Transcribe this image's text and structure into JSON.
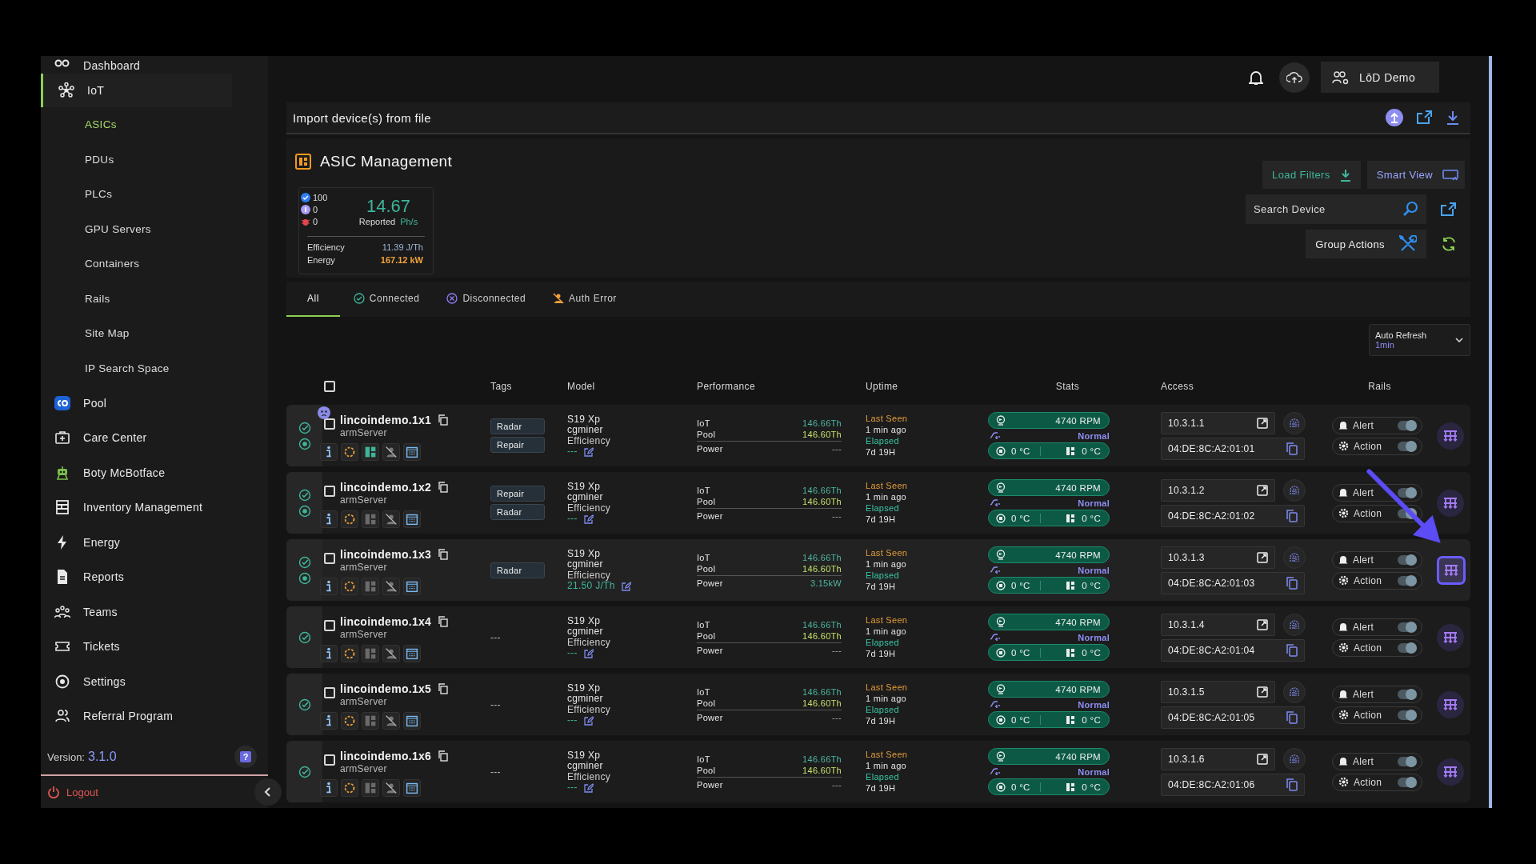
{
  "sidebar": {
    "items": [
      {
        "label": "Dashboard",
        "selected": false
      },
      {
        "label": "IoT",
        "selected": true,
        "children": [
          {
            "label": "ASICs",
            "selected": true
          },
          {
            "label": "PDUs",
            "selected": false
          },
          {
            "label": "PLCs",
            "selected": false
          },
          {
            "label": "GPU Servers",
            "selected": false
          },
          {
            "label": "Containers",
            "selected": false
          },
          {
            "label": "Rails",
            "selected": false
          },
          {
            "label": "Site Map",
            "selected": false
          },
          {
            "label": "IP Search Space",
            "selected": false
          }
        ]
      },
      {
        "label": "Pool",
        "selected": false
      },
      {
        "label": "Care Center",
        "selected": false
      },
      {
        "label": "Boty McBotface",
        "selected": false
      },
      {
        "label": "Inventory Management",
        "selected": false
      },
      {
        "label": "Energy",
        "selected": false
      },
      {
        "label": "Reports",
        "selected": false
      },
      {
        "label": "Teams",
        "selected": false
      },
      {
        "label": "Tickets",
        "selected": false
      },
      {
        "label": "Settings",
        "selected": false
      },
      {
        "label": "Referral Program",
        "selected": false
      }
    ],
    "version": {
      "label": "Version:",
      "value": "3.1.0"
    },
    "help": "?",
    "logout": "Logout"
  },
  "topbar": {
    "user": "LōD Demo"
  },
  "import_bar": {
    "title": "Import device(s) from file"
  },
  "asic_panel": {
    "title": "ASIC Management",
    "summary": {
      "counts": [
        {
          "value": "100",
          "color": "#2f7df6"
        },
        {
          "value": "0",
          "color": "#a99cf5"
        },
        {
          "value": "0",
          "color": "#e0474c"
        }
      ],
      "hashrate": "14.67",
      "hashrate_label": "Reported",
      "hashrate_unit": "Ph/s",
      "metrics": [
        {
          "label": "Efficiency",
          "value": "11.39 J/Th"
        },
        {
          "label": "Energy",
          "value": "167.12 kW"
        }
      ]
    },
    "load_filters": "Load Filters",
    "smart_view": "Smart View",
    "search": {
      "placeholder": "Search Device"
    },
    "group_actions": "Group Actions"
  },
  "tabs": [
    {
      "label": "All",
      "kind": "all",
      "selected": true
    },
    {
      "label": "Connected",
      "kind": "connected",
      "selected": false
    },
    {
      "label": "Disconnected",
      "kind": "disconnected",
      "selected": false
    },
    {
      "label": "Auth Error",
      "kind": "auth_error",
      "selected": false
    }
  ],
  "auto_refresh": {
    "label": "Auto Refresh",
    "value": "1min"
  },
  "table": {
    "select_all": {
      "checked": false
    },
    "columns": [
      "Tags",
      "Model",
      "Performance",
      "Uptime",
      "Stats",
      "Access",
      "Rails"
    ],
    "rows": [
      {
        "name": "lincoindemo.1x1",
        "server": "armServer",
        "checked": false,
        "hovered": false,
        "notice": true,
        "connected": true,
        "online": true,
        "layout_active": true,
        "tags": [
          "Radar",
          "Repair"
        ],
        "model": "S19 Xp",
        "miner": "cgminer",
        "efficiency_label": "Efficiency",
        "efficiency": "---",
        "perf": [
          {
            "label": "IoT",
            "value": "146.66Th"
          },
          {
            "label": "Pool",
            "value": "146.60Th"
          },
          {
            "label": "Power",
            "value": "---"
          }
        ],
        "last_seen_label": "Last Seen",
        "last_seen": "1 min ago",
        "elapsed_label": "Elapsed",
        "elapsed": "7d 19H",
        "rpm": "4740 RPM",
        "power_mode": "Normal",
        "temps": [
          "0 °C",
          "0 °C"
        ],
        "ip": "10.3.1.1",
        "mac": "04:DE:8C:A2:01:01",
        "rails": [
          {
            "label": "Alert",
            "on": true
          },
          {
            "label": "Action",
            "on": true
          }
        ]
      },
      {
        "name": "lincoindemo.1x2",
        "server": "armServer",
        "checked": false,
        "hovered": false,
        "notice": false,
        "connected": true,
        "online": true,
        "layout_active": false,
        "tags": [
          "Repair",
          "Radar"
        ],
        "model": "S19 Xp",
        "miner": "cgminer",
        "efficiency_label": "Efficiency",
        "efficiency": "---",
        "perf": [
          {
            "label": "IoT",
            "value": "146.66Th"
          },
          {
            "label": "Pool",
            "value": "146.60Th"
          },
          {
            "label": "Power",
            "value": "---"
          }
        ],
        "last_seen_label": "Last Seen",
        "last_seen": "1 min ago",
        "elapsed_label": "Elapsed",
        "elapsed": "7d 19H",
        "rpm": "4740 RPM",
        "power_mode": "Normal",
        "temps": [
          "0 °C",
          "0 °C"
        ],
        "ip": "10.3.1.2",
        "mac": "04:DE:8C:A2:01:02",
        "rails": [
          {
            "label": "Alert",
            "on": true
          },
          {
            "label": "Action",
            "on": true
          }
        ]
      },
      {
        "name": "lincoindemo.1x3",
        "server": "armServer",
        "checked": false,
        "hovered": true,
        "notice": false,
        "connected": true,
        "online": true,
        "layout_active": false,
        "tags": [
          "Radar"
        ],
        "model": "S19 Xp",
        "miner": "cgminer",
        "efficiency_label": "Efficiency",
        "efficiency": "21.50 J/Th",
        "perf": [
          {
            "label": "IoT",
            "value": "146.66Th"
          },
          {
            "label": "Pool",
            "value": "146.60Th"
          },
          {
            "label": "Power",
            "value": "3.15kW"
          }
        ],
        "last_seen_label": "Last Seen",
        "last_seen": "1 min ago",
        "elapsed_label": "Elapsed",
        "elapsed": "7d 19H",
        "rpm": "4740 RPM",
        "power_mode": "Normal",
        "temps": [
          "0 °C",
          "0 °C"
        ],
        "ip": "10.3.1.3",
        "mac": "04:DE:8C:A2:01:03",
        "rails": [
          {
            "label": "Alert",
            "on": true
          },
          {
            "label": "Action",
            "on": true
          }
        ]
      },
      {
        "name": "lincoindemo.1x4",
        "server": "armServer",
        "checked": false,
        "hovered": false,
        "notice": false,
        "connected": true,
        "online": false,
        "layout_active": false,
        "tags_empty": "---",
        "model": "S19 Xp",
        "miner": "cgminer",
        "efficiency_label": "Efficiency",
        "efficiency": "---",
        "perf": [
          {
            "label": "IoT",
            "value": "146.66Th"
          },
          {
            "label": "Pool",
            "value": "146.60Th"
          },
          {
            "label": "Power",
            "value": "---"
          }
        ],
        "last_seen_label": "Last Seen",
        "last_seen": "1 min ago",
        "elapsed_label": "Elapsed",
        "elapsed": "7d 19H",
        "rpm": "4740 RPM",
        "power_mode": "Normal",
        "temps": [
          "0 °C",
          "0 °C"
        ],
        "ip": "10.3.1.4",
        "mac": "04:DE:8C:A2:01:04",
        "rails": [
          {
            "label": "Alert",
            "on": true
          },
          {
            "label": "Action",
            "on": true
          }
        ]
      },
      {
        "name": "lincoindemo.1x5",
        "server": "armServer",
        "checked": false,
        "hovered": false,
        "notice": false,
        "connected": true,
        "online": false,
        "layout_active": false,
        "tags_empty": "---",
        "model": "S19 Xp",
        "miner": "cgminer",
        "efficiency_label": "Efficiency",
        "efficiency": "---",
        "perf": [
          {
            "label": "IoT",
            "value": "146.66Th"
          },
          {
            "label": "Pool",
            "value": "146.60Th"
          },
          {
            "label": "Power",
            "value": "---"
          }
        ],
        "last_seen_label": "Last Seen",
        "last_seen": "1 min ago",
        "elapsed_label": "Elapsed",
        "elapsed": "7d 19H",
        "rpm": "4740 RPM",
        "power_mode": "Normal",
        "temps": [
          "0 °C",
          "0 °C"
        ],
        "ip": "10.3.1.5",
        "mac": "04:DE:8C:A2:01:05",
        "rails": [
          {
            "label": "Alert",
            "on": true
          },
          {
            "label": "Action",
            "on": true
          }
        ]
      },
      {
        "name": "lincoindemo.1x6",
        "server": "armServer",
        "checked": false,
        "hovered": false,
        "notice": false,
        "connected": true,
        "online": false,
        "layout_active": false,
        "tags_empty": "---",
        "model": "S19 Xp",
        "miner": "cgminer",
        "efficiency_label": "Efficiency",
        "efficiency": "---",
        "perf": [
          {
            "label": "IoT",
            "value": "146.66Th"
          },
          {
            "label": "Pool",
            "value": "146.60Th"
          },
          {
            "label": "Power",
            "value": "---"
          }
        ],
        "last_seen_label": "Last Seen",
        "last_seen": "1 min ago",
        "elapsed_label": "Elapsed",
        "elapsed": "7d 19H",
        "rpm": "4740 RPM",
        "power_mode": "Normal",
        "temps": [
          "0 °C",
          "0 °C"
        ],
        "ip": "10.3.1.6",
        "mac": "04:DE:8C:A2:01:06",
        "rails": [
          {
            "label": "Alert",
            "on": true
          },
          {
            "label": "Action",
            "on": true
          }
        ]
      }
    ]
  }
}
